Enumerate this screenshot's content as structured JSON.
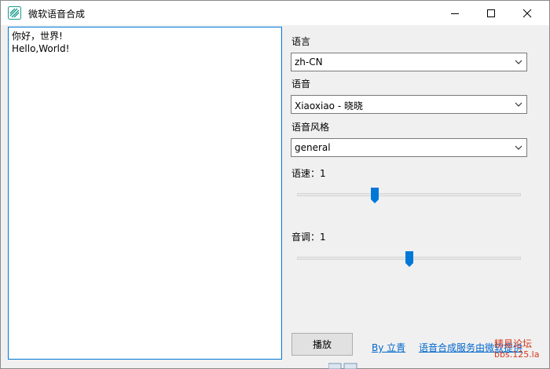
{
  "window": {
    "title": "微软语音合成"
  },
  "editor": {
    "text": "你好，世界!\nHello,World!"
  },
  "language": {
    "label": "语言",
    "value": "zh-CN"
  },
  "voice": {
    "label": "语音",
    "value": "Xiaoxiao - 晓晓"
  },
  "style": {
    "label": "语音风格",
    "value": "general"
  },
  "rate": {
    "label": "语速：1",
    "level": 0.34
  },
  "pitch": {
    "label": "音调：1",
    "level": 0.5
  },
  "actions": {
    "play_label": "播放"
  },
  "links": {
    "author": "By 立青",
    "service": "语音合成服务由微软提供"
  },
  "watermark": {
    "line1": "精易论坛",
    "line2": "bbs.125.la"
  },
  "colors": {
    "accent": "#0078d7",
    "link": "#0066cc",
    "watermark": "#d53a20"
  }
}
